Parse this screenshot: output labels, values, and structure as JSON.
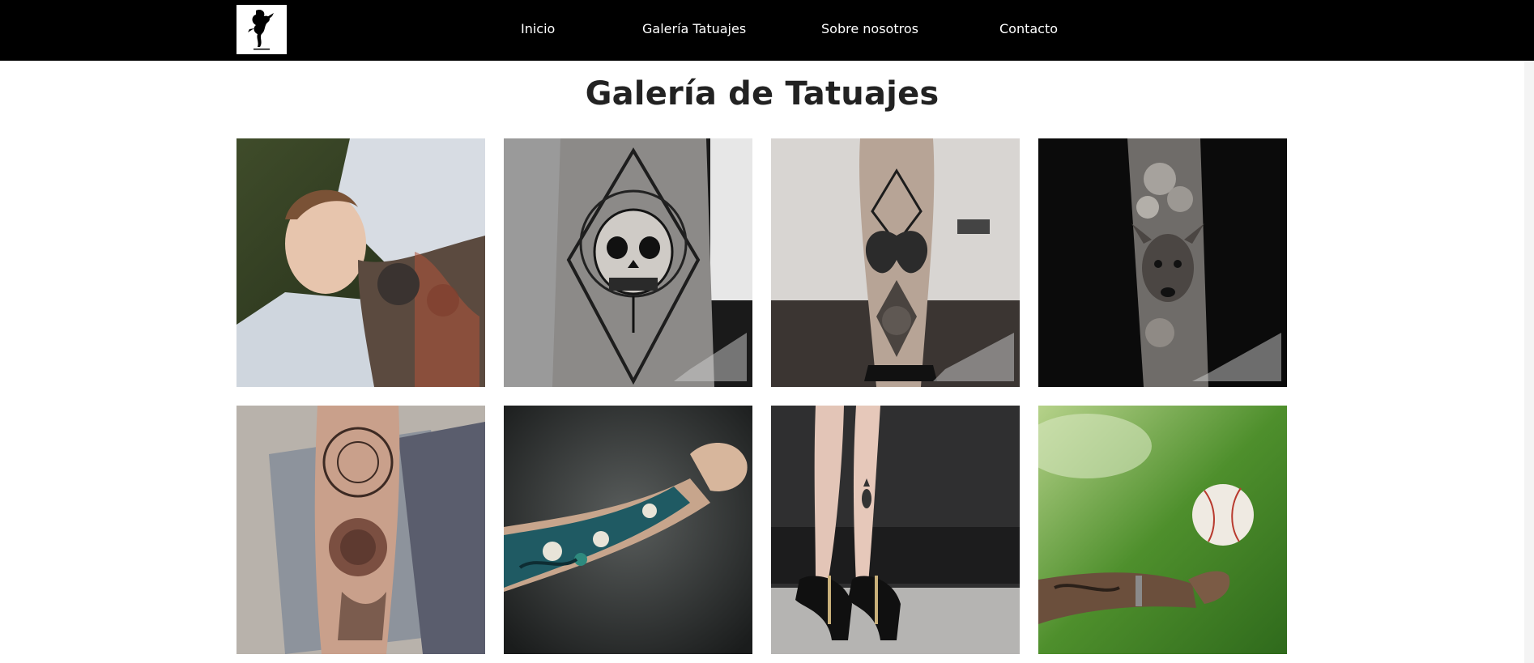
{
  "nav": {
    "logo_alt": "logo",
    "links": [
      "Inicio",
      "Galería Tatuajes",
      "Sobre nosotros",
      "Contacto"
    ]
  },
  "page": {
    "title": "Galería de Tatuajes"
  },
  "gallery": {
    "images": [
      {
        "icon": "neck-tattoo-photo"
      },
      {
        "icon": "skull-forearm-tattoo-photo"
      },
      {
        "icon": "butterfly-leg-tattoo-photo"
      },
      {
        "icon": "deer-sleeve-tattoo-photo"
      },
      {
        "icon": "rose-mandala-tattoo-photo"
      },
      {
        "icon": "japanese-sleeve-tattoo-photo"
      },
      {
        "icon": "pineapple-ankle-tattoo-photo"
      },
      {
        "icon": "baseball-arm-tattoo-photo"
      }
    ]
  },
  "colors": {
    "navbar": "#000000",
    "title": "#222222",
    "background": "#ffffff"
  }
}
